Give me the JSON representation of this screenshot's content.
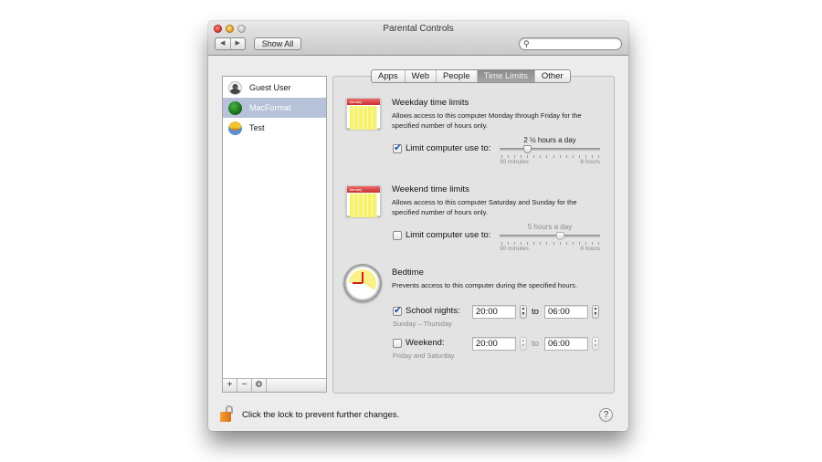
{
  "window": {
    "title": "Parental Controls"
  },
  "toolbar": {
    "back_icon": "◀",
    "forward_icon": "▶",
    "show_all_label": "Show All",
    "search_icon": "⚲",
    "search_placeholder": ""
  },
  "users": [
    {
      "name": "Guest User",
      "avatar": "guest-silhouette-icon",
      "selected": false
    },
    {
      "name": "MacFormat",
      "avatar": "green-globe-icon",
      "selected": true
    },
    {
      "name": "Test",
      "avatar": "sunflower-icon",
      "selected": false
    }
  ],
  "list_buttons": {
    "add": "+",
    "remove": "−",
    "action": "⚙"
  },
  "tabs": [
    {
      "label": "Apps",
      "active": false
    },
    {
      "label": "Web",
      "active": false
    },
    {
      "label": "People",
      "active": false
    },
    {
      "label": "Time Limits",
      "active": true
    },
    {
      "label": "Other",
      "active": false
    }
  ],
  "weekday": {
    "title": "Weekday time limits",
    "description": "Allows access to this computer Monday through Friday for the specified number of hours only.",
    "checkbox_label": "Limit computer use to:",
    "checked": true,
    "value_label": "2 ½ hours a day",
    "value_hours": 2.5,
    "min_label": "30 minutes",
    "max_label": "8 hours",
    "min_hours": 0.5,
    "max_hours": 8,
    "calendar_month": "January"
  },
  "weekend": {
    "title": "Weekend time limits",
    "description": "Allows access to this computer Saturday and Sunday for the specified number of hours only.",
    "checkbox_label": "Limit computer use to:",
    "checked": false,
    "value_label": "5 hours a day",
    "value_hours": 5,
    "min_label": "30 minutes",
    "max_label": "8 hours",
    "min_hours": 0.5,
    "max_hours": 8,
    "calendar_month": "January"
  },
  "bedtime": {
    "title": "Bedtime",
    "description": "Prevents access to this computer during the specified hours.",
    "school_nights": {
      "label": "School nights:",
      "checked": true,
      "sublabel": "Sunday – Thursday",
      "from": "20:00",
      "to_label": "to",
      "to": "06:00"
    },
    "weekend": {
      "label": "Weekend:",
      "checked": false,
      "sublabel": "Friday and Saturday",
      "from": "20:00",
      "to_label": "to",
      "to": "06:00"
    }
  },
  "footer": {
    "lock_text": "Click the lock to prevent further changes.",
    "help_label": "?"
  },
  "colors": {
    "selection": "#b6c2d8",
    "active_tab": "#9a9a9a",
    "checkmark": "#1b4fa8",
    "lock": "#e8861f"
  }
}
